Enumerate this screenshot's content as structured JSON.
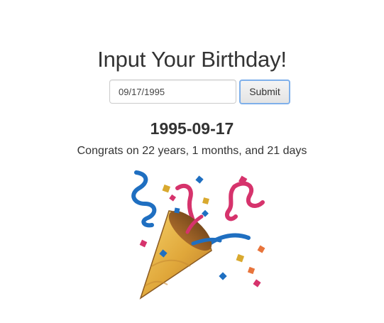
{
  "header": {
    "title": "Input Your Birthday!"
  },
  "form": {
    "date_value": "09/17/1995",
    "submit_label": "Submit"
  },
  "result": {
    "date": "1995-09-17",
    "message": "Congrats on 22 years, 1 months, and 21 days"
  },
  "illustration": {
    "icon": "party-popper-icon"
  },
  "colors": {
    "text": "#333333",
    "button_focus_border": "#7fb0ea",
    "input_border": "#cccccc"
  }
}
